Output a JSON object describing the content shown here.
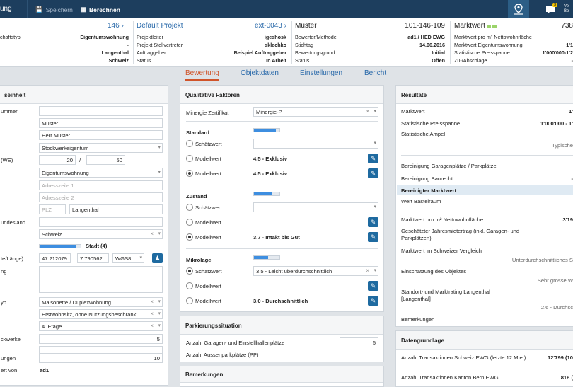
{
  "topbar": {
    "title": "ung",
    "save_label": "Speichern",
    "calc_label": "Berechnen",
    "badge": "3",
    "user_line1": "Ve",
    "user_line2": "Be"
  },
  "info": {
    "col1": {
      "head": "146",
      "rows": [
        {
          "label": "chaftstyp",
          "value": "Eigentumswohnung"
        },
        {
          "label": "",
          "value": "-"
        },
        {
          "label": "",
          "value": "Langenthal"
        },
        {
          "label": "",
          "value": "Schweiz"
        }
      ]
    },
    "col2": {
      "head": "Default Projekt",
      "head_right": "ext-0043",
      "rows": [
        {
          "label": "Projektleiter",
          "value": "igeshosk"
        },
        {
          "label": "Projekt Stellvertreter",
          "value": "sklechko"
        },
        {
          "label": "Auftraggeber",
          "value": "Beispiel Auftraggeber"
        },
        {
          "label": "Status",
          "value": "In Arbeit"
        }
      ]
    },
    "col3": {
      "head": "Muster",
      "head_right": "101-146-109",
      "rows": [
        {
          "label": "Bewerter/Methode",
          "value": "ad1 / HED EWG"
        },
        {
          "label": "Stichtag",
          "value": "14.06.2016"
        },
        {
          "label": "Bewertungsgrund",
          "value": "Initial"
        },
        {
          "label": "Status",
          "value": "Offen"
        }
      ]
    },
    "col4": {
      "head": "Marktwert",
      "head_right": "738",
      "rows": [
        {
          "label": "Marktwert pro m² Nettowohnfläche",
          "value": ""
        },
        {
          "label": "Marktwert Eigentumswohnung",
          "value": "1'1"
        },
        {
          "label": "Statistische Preisspanne",
          "value": "1'000'000-1'2"
        },
        {
          "label": "Zu-/Abschläge",
          "value": "-"
        }
      ]
    }
  },
  "tabs": [
    "Bewertung",
    "Objektdaten",
    "Einstellungen",
    "Bericht"
  ],
  "left_panel": {
    "title": "seinheit",
    "labels": [
      "ummer",
      "",
      "",
      "(WE)",
      "",
      "",
      "",
      "",
      "undesland",
      "",
      "",
      "te/Länge)",
      "ng",
      "",
      "yp",
      "",
      "",
      "ckwerke",
      "",
      "ungen",
      "ert von"
    ],
    "name": "Muster",
    "salutation": "Herr Muster",
    "ownership": "Stockwerkeigentum",
    "we_a": "20",
    "we_sep": "/",
    "we_b": "50",
    "objtype": "Eigentumswohnung",
    "addr1": "Adresszeile 1",
    "addr2": "Adresszeile 2",
    "plz": "PLZ",
    "city": "Langenthal",
    "country": "Schweiz",
    "stadt": "Stadt (4)",
    "lat": "47.212079",
    "lng": "7.790562",
    "crs": "WGS8",
    "subtype": "Maisonette / Duplexwohnung",
    "usage": "Erstwohnsitz, ohne Nutzungsbeschränk",
    "floor": "4. Etage",
    "floors": "5",
    "rooms": "10",
    "bewertet_von": "ad1"
  },
  "qual_panel": {
    "title": "Qualitative Faktoren",
    "minergie_label": "Minergie Zertifikat",
    "minergie_value": "Minergie-P",
    "groups": [
      {
        "title": "Standard",
        "rating": 0.85,
        "schaetz_label": "Schätzwert",
        "schaetz_value": "",
        "modell_label": "Modellwert",
        "modell_value": "4.5 - Exklusiv",
        "modell2_label": "Modellwert",
        "modell2_value": "4.5 - Exklusiv"
      },
      {
        "title": "Zustand",
        "rating": 0.7,
        "schaetz_label": "Schätzwert",
        "schaetz_value": "",
        "modell_label": "Modellwert",
        "modell_value": "",
        "modell2_label": "Modellwert",
        "modell2_value": "3.7 - Intakt bis Gut"
      },
      {
        "title": "Mikrolage",
        "rating": 0.55,
        "schaetz_label": "Schätzwert",
        "schaetz_value": "3.5 - Leicht überdurchschnittlich",
        "modell_label": "Modellwert",
        "modell_value": "",
        "modell2_label": "Modellwert",
        "modell2_value": "3.0 - Durchschnittlich"
      }
    ]
  },
  "parking_panel": {
    "title": "Parkierungssituation",
    "garage_label": "Anzahl Garagen- und Einstellhallenplätze",
    "garage_value": "5",
    "outdoor_label": "Anzahl Aussenparkplätze (PP)",
    "outdoor_value": ""
  },
  "remarks_panel": {
    "title": "Bemerkungen"
  },
  "results_panel": {
    "title": "Resultate",
    "rows": [
      {
        "label": "Marktwert",
        "value": "1'"
      },
      {
        "label": "Statistische Preisspanne",
        "value": "1'000'000 - 1'"
      },
      {
        "label": "Statistische Ampel",
        "value": ""
      },
      {
        "label": "",
        "value": "Typische"
      },
      {
        "label": "Bereinigung Garagenplätze / Parkplätze",
        "value": ""
      },
      {
        "label": "Bereinigung Baurecht",
        "value": "-"
      },
      {
        "label": "Bereinigter Marktwert",
        "value": ""
      },
      {
        "label": "Wert Bastelraum",
        "value": ""
      },
      {
        "label": "Marktwert pro m² Nettowohnfläche",
        "value": "3'19"
      },
      {
        "label": "Geschätzter Jahresmietertrag (inkl. Garagen- und Parkplätzen)",
        "value": ""
      },
      {
        "label": "Marktwert im Schweizer Vergleich",
        "value": ""
      },
      {
        "label": "",
        "value": "Unterdurchschnittliches S"
      },
      {
        "label": "Einschätzung des Objektes",
        "value": ""
      },
      {
        "label": "",
        "value": "Sehr grosse W"
      },
      {
        "label": "Standort- und Marktrating Langenthal [Langenthal]",
        "value": ""
      },
      {
        "label": "",
        "value": "2.6 - Durchsc"
      },
      {
        "label": "Bemerkungen",
        "value": ""
      }
    ]
  },
  "market_panel": {
    "title": "Datengrundlage",
    "rows": [
      {
        "label": "Anzahl Transaktionen Schweiz EWG (letzte 12 Mte.)",
        "value": "12'799 (10"
      },
      {
        "label": "Anzahl Transaktionen Kanton Bern EWG",
        "value": "816 ("
      }
    ]
  },
  "colors": {
    "topbar": "#1d3e5e",
    "accent": "#d0542a",
    "link": "#2a6aaa",
    "button": "#1e6aa0"
  }
}
